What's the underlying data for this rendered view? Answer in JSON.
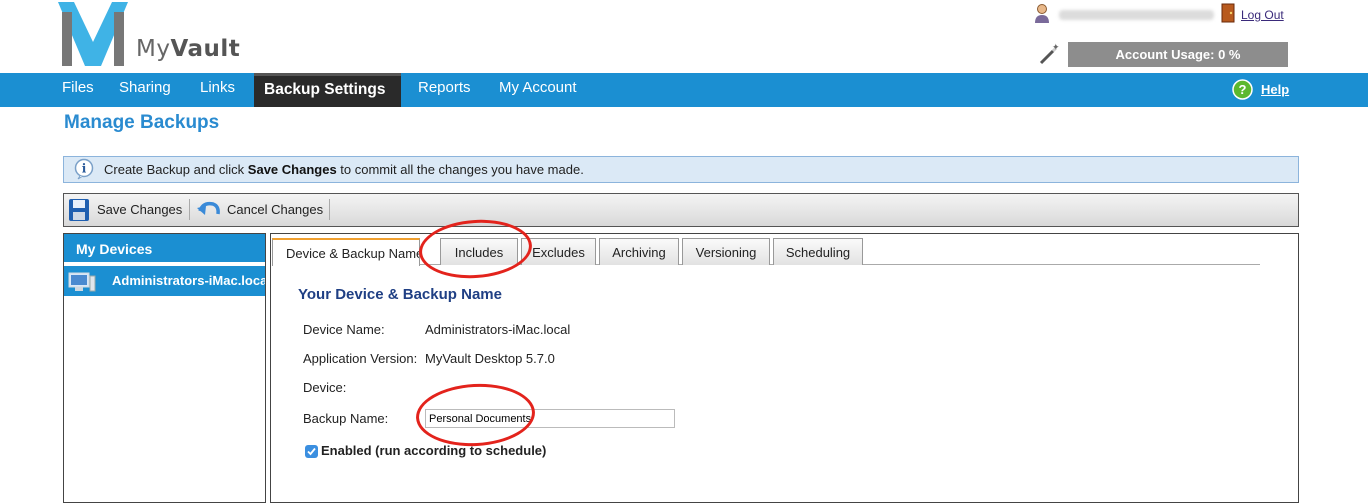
{
  "header": {
    "logo_text_a": "My",
    "logo_text_b": "Vault",
    "logout": "Log Out",
    "account_usage": "Account Usage: 0 %"
  },
  "nav": {
    "items": [
      "Files",
      "Sharing",
      "Links",
      "Backup Settings",
      "Reports",
      "My Account"
    ],
    "help": "Help"
  },
  "page_title": "Manage Backups",
  "info": {
    "pre": "Create Backup and click ",
    "bold": "Save Changes",
    "post": " to commit all the changes you have made."
  },
  "toolbar": {
    "save": "Save Changes",
    "cancel": "Cancel Changes"
  },
  "devices": {
    "title": "My Devices",
    "items": [
      "Administrators-iMac.local"
    ]
  },
  "tabs": [
    "Device & Backup Name",
    "Includes",
    "Excludes",
    "Archiving",
    "Versioning",
    "Scheduling"
  ],
  "form": {
    "section_title": "Your Device & Backup Name",
    "device_name_label": "Device Name:",
    "device_name_value": "Administrators-iMac.local",
    "app_version_label": "Application Version:",
    "app_version_value": "MyVault Desktop 5.7.0",
    "device_label": "Device:",
    "backup_name_label": "Backup Name:",
    "backup_name_value": "Personal Documents",
    "enabled_label": "Enabled (run according to schedule)",
    "enabled_checked": true
  },
  "colors": {
    "nav_blue": "#1b8fd2",
    "annotation_red": "#e3231c"
  }
}
